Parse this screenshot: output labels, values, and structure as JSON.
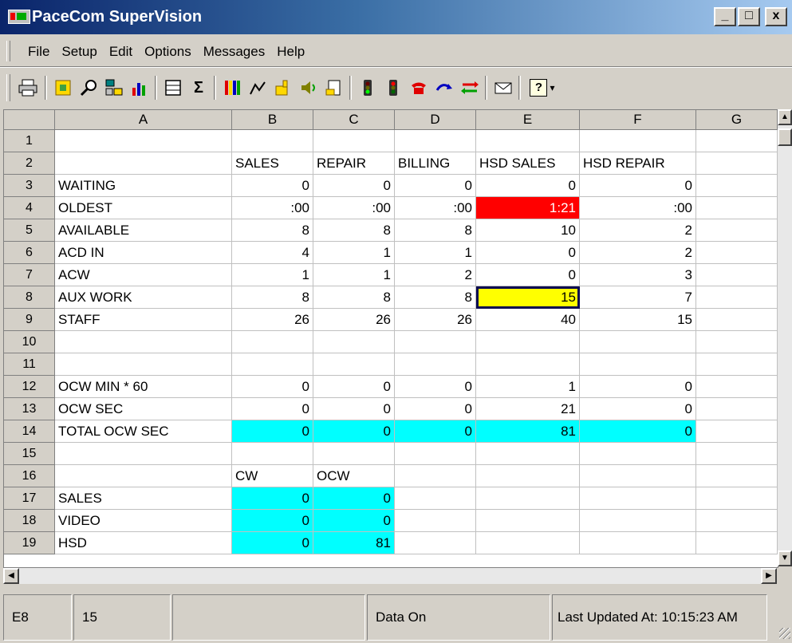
{
  "window": {
    "title": "PaceCom SuperVision",
    "controls": [
      "_",
      "□",
      "x"
    ]
  },
  "menu": [
    "File",
    "Setup",
    "Edit",
    "Options",
    "Messages",
    "Help"
  ],
  "toolbar": {
    "icons": [
      "print-icon",
      "configure-icon",
      "find-icon",
      "network-icon",
      "bar-chart-icon",
      "list-icon",
      "sum-icon",
      "color-bars-icon",
      "line-graph-icon",
      "thumbs-up-icon",
      "audio-icon",
      "notes-icon",
      "traffic-light-green-icon",
      "traffic-light-red-icon",
      "phone-icon",
      "redirect-icon",
      "transfer-icon",
      "mail-icon",
      "help-icon"
    ],
    "help_glyph": "?"
  },
  "sheet": {
    "columns": [
      "A",
      "B",
      "C",
      "D",
      "E",
      "F",
      "G"
    ],
    "rows": [
      "1",
      "2",
      "3",
      "4",
      "5",
      "6",
      "7",
      "8",
      "9",
      "10",
      "11",
      "12",
      "13",
      "14",
      "15",
      "16",
      "17",
      "18",
      "19"
    ],
    "cells": [
      [
        "",
        "",
        "",
        "",
        "",
        "",
        ""
      ],
      [
        "",
        "SALES",
        "REPAIR",
        "BILLING",
        "HSD SALES",
        "HSD REPAIR",
        ""
      ],
      [
        "WAITING",
        "0",
        "0",
        "0",
        "0",
        "0",
        ""
      ],
      [
        "OLDEST",
        ":00",
        ":00",
        ":00",
        "1:21",
        ":00",
        ""
      ],
      [
        "AVAILABLE",
        "8",
        "8",
        "8",
        "10",
        "2",
        ""
      ],
      [
        "ACD IN",
        "4",
        "1",
        "1",
        "0",
        "2",
        ""
      ],
      [
        "ACW",
        "1",
        "1",
        "2",
        "0",
        "3",
        ""
      ],
      [
        "AUX WORK",
        "8",
        "8",
        "8",
        "15",
        "7",
        ""
      ],
      [
        "STAFF",
        "26",
        "26",
        "26",
        "40",
        "15",
        ""
      ],
      [
        "",
        "",
        "",
        "",
        "",
        "",
        ""
      ],
      [
        "",
        "",
        "",
        "",
        "",
        "",
        ""
      ],
      [
        "OCW MIN * 60",
        "0",
        "0",
        "0",
        "1",
        "0",
        ""
      ],
      [
        "OCW SEC",
        "0",
        "0",
        "0",
        "21",
        "0",
        ""
      ],
      [
        "TOTAL OCW SEC",
        "0",
        "0",
        "0",
        "81",
        "0",
        ""
      ],
      [
        "",
        "",
        "",
        "",
        "",
        "",
        ""
      ],
      [
        "",
        "CW",
        "OCW",
        "",
        "",
        "",
        ""
      ],
      [
        "SALES",
        "0",
        "0",
        "",
        "",
        "",
        ""
      ],
      [
        "VIDEO",
        "0",
        "0",
        "",
        "",
        "",
        ""
      ],
      [
        "HSD",
        "0",
        "81",
        "",
        "",
        "",
        ""
      ]
    ],
    "highlights": {
      "red": "#ff0000",
      "yellow": "#ffff00",
      "cyan": "#00ffff"
    },
    "selected_cell": "E8"
  },
  "status": {
    "cell_ref": "E8",
    "cell_value": "15",
    "empty": "",
    "data_state": "Data On",
    "last_updated": "Last Updated At: 10:15:23 AM"
  }
}
